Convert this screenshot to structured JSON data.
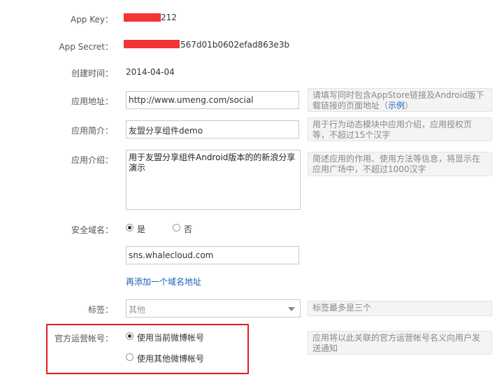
{
  "fields": {
    "app_key": {
      "label": "App Key：",
      "value_suffix": "212"
    },
    "app_secret": {
      "label": "App Secret：",
      "value_suffix": "567d01b0602efad863e3b"
    },
    "created": {
      "label": "创建时间：",
      "value": "2014-04-04"
    },
    "app_url": {
      "label": "应用地址：",
      "value": "http://www.umeng.com/social",
      "hint_text": "请填写同时包含AppStore链接及Android版下载链接的页面地址（",
      "hint_link": "示例",
      "hint_end": "）"
    },
    "app_brief": {
      "label": "应用简介：",
      "value": "友盟分享组件demo",
      "hint": "用于行为动态模块中应用介绍，应用授权页等，不超过15个汉字"
    },
    "app_intro": {
      "label": "应用介绍：",
      "value": "用于友盟分享组件Android版本的的新浪分享演示",
      "hint": "简述应用的作用、使用方法等信息，将显示在应用广场中，不超过1000汉字"
    },
    "secure_domain": {
      "label": "安全域名：",
      "yes": "是",
      "no": "否",
      "selected": "yes",
      "value": "sns.whalecloud.com",
      "add_link": "再添加一个域名地址"
    },
    "tags": {
      "label": "标签：",
      "selected": "其他",
      "hint": "标签最多是三个"
    },
    "official_account": {
      "label": "官方运营帐号：",
      "option1": "使用当前微博帐号",
      "option2": "使用其他微博帐号",
      "selected": "option1",
      "hint": "应用将以此关联的官方运营帐号名义向用户发送通知"
    }
  },
  "colors": {
    "redaction": "#f23535",
    "highlight_border": "#e31d1d",
    "link": "#1a62b8"
  }
}
